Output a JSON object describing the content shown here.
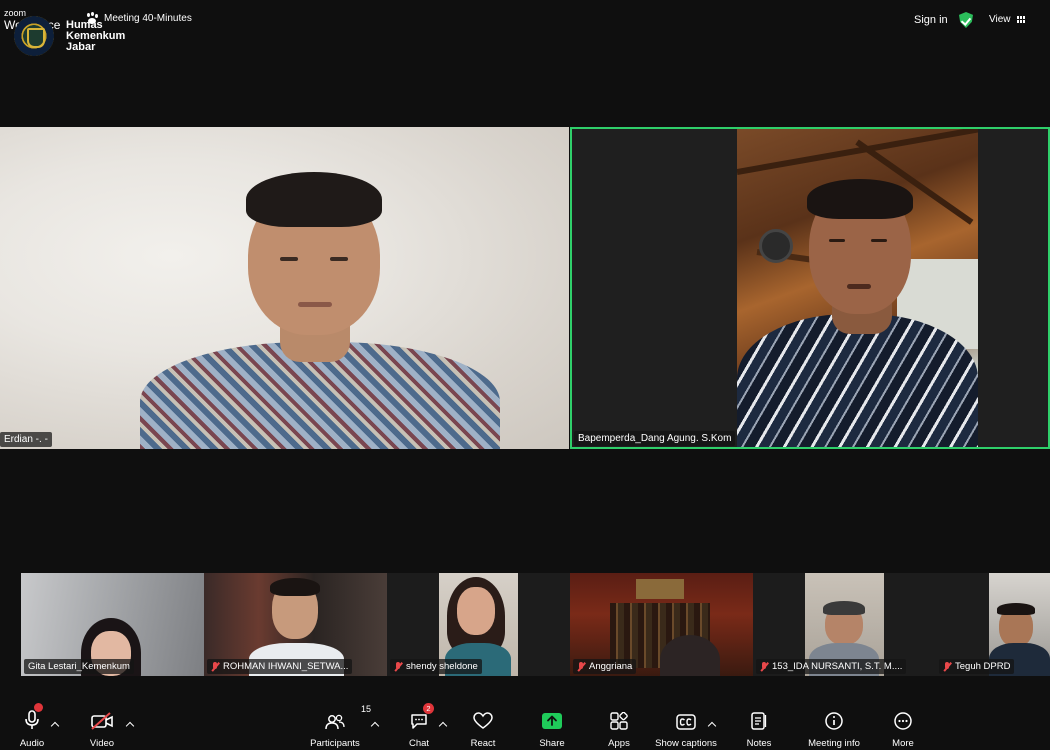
{
  "app": {
    "brand_top": "zoom",
    "brand_bottom": "Workplace"
  },
  "org_overlay": {
    "line1": "Humas",
    "line2": "Kemenkum",
    "line3": "Jabar"
  },
  "meeting": {
    "title": "Meeting 40-Minutes"
  },
  "topbar": {
    "sign_in": "Sign in",
    "view": "View"
  },
  "main_tiles": [
    {
      "name": "Erdian -. -",
      "active_speaker": false
    },
    {
      "name": "Bapemperda_Dang Agung. S.Kom",
      "active_speaker": true
    }
  ],
  "strip": [
    {
      "name": "Gita Lestari_Kemenkum",
      "muted": false
    },
    {
      "name": "ROHMAN IHWANI_SETWA...",
      "muted": true
    },
    {
      "name": "shendy sheldone",
      "muted": true
    },
    {
      "name": "Anggriana",
      "muted": true
    },
    {
      "name": "153_IDA NURSANTI, S.T. M....",
      "muted": true
    },
    {
      "name": "Teguh DPRD",
      "muted": true
    }
  ],
  "toolbar": {
    "audio": "Audio",
    "video": "Video",
    "participants": "Participants",
    "participants_count": "15",
    "chat": "Chat",
    "chat_badge": "2",
    "react": "React",
    "share": "Share",
    "apps": "Apps",
    "captions": "Show captions",
    "notes": "Notes",
    "meeting_info": "Meeting info",
    "more": "More"
  },
  "colors": {
    "active_border": "#2fcf6a",
    "share_green": "#1fcb5a",
    "muted_red": "#e8484a",
    "badge_red": "#e0353a"
  }
}
